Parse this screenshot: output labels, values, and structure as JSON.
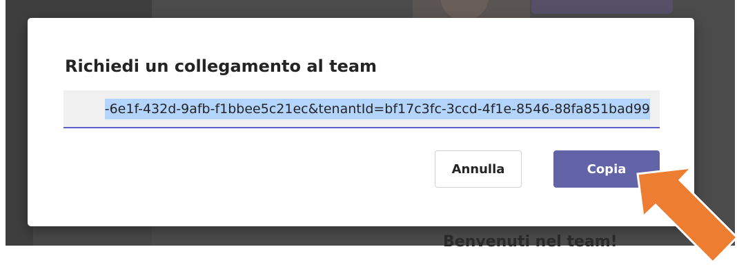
{
  "background": {
    "welcome_text": "Benvenuti nel team!"
  },
  "dialog": {
    "title": "Richiedi un collegamento al team",
    "link_value": "-6e1f-432d-9afb-f1bbee5c21ec&tenantId=bf17c3fc-3ccd-4f1e-8546-88fa851bad99",
    "cancel_label": "Annulla",
    "copy_label": "Copia"
  },
  "colors": {
    "primary": "#6264a7",
    "selection": "#b3d4fc",
    "annotation_arrow": "#ed7d31"
  },
  "icons": {
    "annotation": "arrow-pointing-to-copy-button"
  }
}
